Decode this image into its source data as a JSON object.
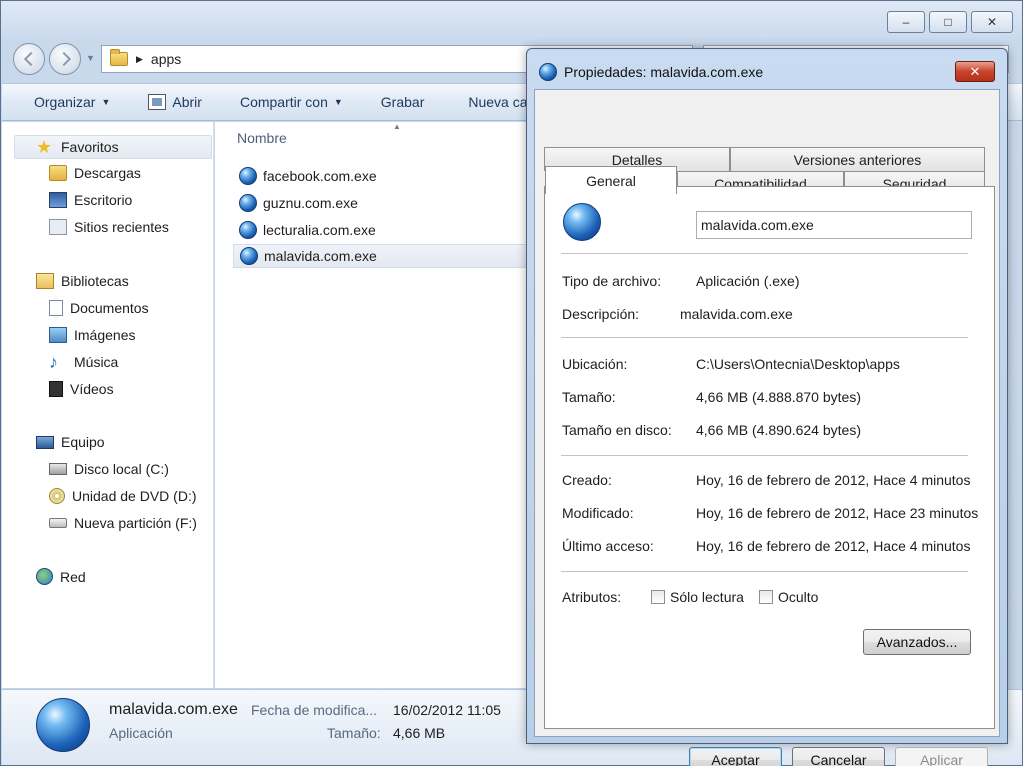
{
  "explorer": {
    "window_controls": {
      "minimize": "‒",
      "maximize": "□",
      "close": "✕"
    },
    "address": {
      "crumb": "apps"
    },
    "toolbar": {
      "organize": "Organizar",
      "open": "Abrir",
      "share": "Compartir con",
      "burn": "Grabar",
      "new": "Nueva carpeta"
    },
    "sidebar": {
      "favorites": {
        "label": "Favoritos",
        "items": [
          "Descargas",
          "Escritorio",
          "Sitios recientes"
        ]
      },
      "libraries": {
        "label": "Bibliotecas",
        "items": [
          "Documentos",
          "Imágenes",
          "Música",
          "Vídeos"
        ]
      },
      "computer": {
        "label": "Equipo",
        "items": [
          "Disco local (C:)",
          "Unidad de DVD (D:)",
          "Nueva partición (F:)"
        ]
      },
      "network": {
        "label": "Red"
      }
    },
    "file_list": {
      "column": "Nombre",
      "files": [
        "facebook.com.exe",
        "guznu.com.exe",
        "lecturalia.com.exe",
        "malavida.com.exe"
      ],
      "selected_index": 3
    },
    "details": {
      "name": "malavida.com.exe",
      "type": "Aplicación",
      "modified_label": "Fecha de modifica...",
      "modified_value": "16/02/2012 11:05",
      "size_label": "Tamaño:",
      "size_value": "4,66 MB"
    }
  },
  "dialog": {
    "title": "Propiedades: malavida.com.exe",
    "close": "✕",
    "tabs_top": [
      "Detalles",
      "Versiones anteriores"
    ],
    "tabs_bottom": [
      "General",
      "Compatibilidad",
      "Seguridad"
    ],
    "active_tab": "General",
    "filename": "malavida.com.exe",
    "props": {
      "type_label": "Tipo de archivo:",
      "type_value": "Aplicación (.exe)",
      "desc_label": "Descripción:",
      "desc_value": "malavida.com.exe",
      "loc_label": "Ubicación:",
      "loc_value": "C:\\Users\\Ontecnia\\Desktop\\apps",
      "size_label": "Tamaño:",
      "size_value": "4,66 MB (4.888.870 bytes)",
      "disk_label": "Tamaño en disco:",
      "disk_value": "4,66 MB (4.890.624 bytes)",
      "created_label": "Creado:",
      "created_value": "Hoy, 16 de febrero de 2012, Hace 4 minutos",
      "modified_label": "Modificado:",
      "modified_value": "Hoy, 16 de febrero de 2012, Hace 23 minutos",
      "accessed_label": "Último acceso:",
      "accessed_value": "Hoy, 16 de febrero de 2012, Hace 4 minutos",
      "attr_label": "Atributos:",
      "readonly": "Sólo lectura",
      "hidden": "Oculto"
    },
    "buttons": {
      "advanced": "Avanzados...",
      "ok": "Aceptar",
      "cancel": "Cancelar",
      "apply": "Aplicar"
    }
  }
}
